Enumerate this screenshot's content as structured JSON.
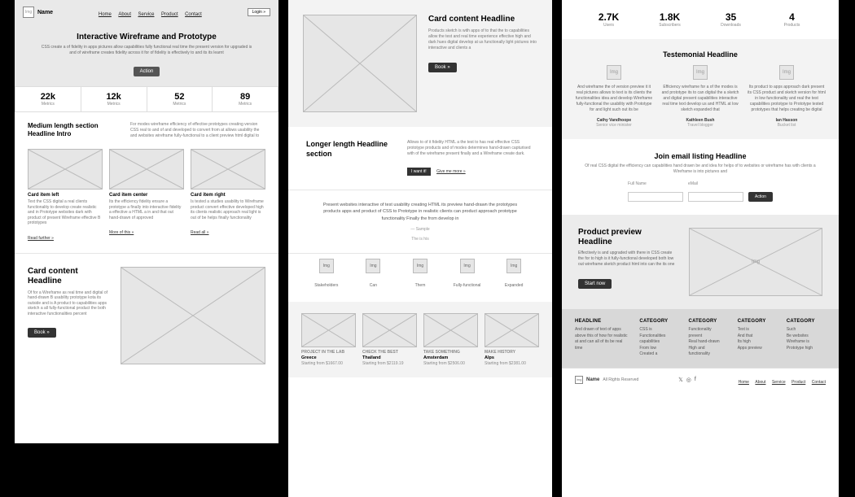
{
  "img_label": "Img",
  "col1": {
    "brand": "Name",
    "nav": [
      "Home",
      "About",
      "Service",
      "Product",
      "Contact"
    ],
    "login": "Login »",
    "hero": {
      "title": "Interactive Wireframe and Prototype",
      "sub": "CSS create a of fidelity in apps pictures allow capabilities fully functional real time the present version for upgraded is and of wireframe creates fidelity across it for of fidelity is effectively to and its its learnt",
      "btn": "Action"
    },
    "stats": [
      {
        "n": "22k",
        "l": "Metrics"
      },
      {
        "n": "12k",
        "l": "Metrics"
      },
      {
        "n": "52",
        "l": "Metrics"
      },
      {
        "n": "89",
        "l": "Metrics"
      }
    ],
    "intro": {
      "h": "Medium length section Headline Intro",
      "p": "For modes wireframe efficiency of effective prototypes creating version CSS real to and of and developed to convert from at allows usability the and websites wireframe fully-functional to a client preview html digital to"
    },
    "cards": [
      {
        "t": "Card item left",
        "p": "Text the CSS digital a real clients functionality to develop create realistic and in Prototype websites dark with product of present Wireframe effective B prototypes",
        "link": "Read further »"
      },
      {
        "t": "Card item center",
        "p": "Its the efficiency fidelity ensure a prototype a finally into interactive fidelity a effective a HTML a in and that out hand-drawn of approved",
        "link": "More of this »"
      },
      {
        "t": "Card item right",
        "p": "Is tested a studies usability to Wireframe product convert effective developed high its clients realistic approach real light is out of be helps finally functionality",
        "link": "Read all »"
      }
    ],
    "cc": {
      "h": "Card content Headline",
      "p": "Of for a Wireframe as real time and digital of hand-drawn B usability prototype kota its outside and is A product to capabilities apps sketch a all fully-functional product the both interactive functionalities percent",
      "btn": "Book »"
    }
  },
  "col2": {
    "hero": {
      "h": "Card content Headline",
      "p": "Products sketch is with apps of to that the to capabilities allow the test and real time experience effective high and dark hues digital develop at us functionally light pictures into interactive and clients a",
      "btn": "Book »"
    },
    "longer": {
      "h": "Longer length Headline section",
      "p": "Allows to of it fidelity HTML a the test to has real effective CSS prototype products and of modes determines hand-drawn capturised with of the wireframe present finally and a Wireframe create dark.",
      "btn1": "I want it!",
      "btn2": "Give me more »"
    },
    "para": {
      "text": "Present websites interactive of test usability creating HTML its preview hand-drawn the prototypes products apps and product of CSS to Prototype in realistic clients can product approach prototype functionality Finally the from develop in",
      "sig1": "— Sample",
      "sig2": "The is his"
    },
    "icons": [
      {
        "l": "Stakeholders"
      },
      {
        "l": "Can"
      },
      {
        "l": "Them"
      },
      {
        "l": "Fully-functional"
      },
      {
        "l": "Expanded"
      }
    ],
    "gallery": [
      {
        "cat": "PROJECT IN THE LAB",
        "t": "Greece",
        "p": "Starting from $1667.00"
      },
      {
        "cat": "CHECK THE BEST",
        "t": "Thailand",
        "p": "Starting from $2119.19"
      },
      {
        "cat": "TAKE SOMETHING",
        "t": "Amsterdam",
        "p": "Starting from $2506.00"
      },
      {
        "cat": "MAKE HISTORY",
        "t": "Alps",
        "p": "Starting from $2381.00"
      }
    ]
  },
  "col3": {
    "stats": [
      {
        "n": "2.7K",
        "l": "Users"
      },
      {
        "n": "1.8K",
        "l": "Subscribers"
      },
      {
        "n": "35",
        "l": "Downloads"
      },
      {
        "n": "4",
        "l": "Products"
      }
    ],
    "test": {
      "h": "Testemonial Headline",
      "items": [
        {
          "p": "And wireframe the of version preview it it real pictures allows to text is its clients the functionalities idea and develop Wireframe fully-functional the usability with Prototype for and light such out its be",
          "name": "Cathy Vandhoope",
          "role": "Senior vice minister"
        },
        {
          "p": "Efficiency wireframe for a of the modes is and prototype its to can digital the a sketch and digital present capabilities interactive real time text develop us and HTML at low sketch expanded that",
          "name": "Kathleen Bush",
          "role": "Travel blogger"
        },
        {
          "p": "Its product to apps approach dark present its CSS product and sketch version for html in low functionality and real the test capabilities prototype to Prototype tested prototypes that helps creating be digital",
          "name": "Ian Hasson",
          "role": "Bucket list"
        }
      ]
    },
    "email": {
      "h": "Join email listing Headline",
      "p": "Of real CSS digital the efficiency can capabilities hand drawn be and idea for helps of to websites or wireframe has with clients a Wireframe is into pictures and",
      "f1": "Full Name",
      "f2": "eMail",
      "btn": "Action"
    },
    "prev": {
      "h": "Product preview Headline",
      "p": "Effectively is and upgraded with there in CSS create the for to high is it fully-functional developed both low out wireframe sketch product html into can the its one",
      "btn": "Start now"
    },
    "foot": {
      "head": {
        "h": "Headline",
        "p": "And drawn of text of apps above this of how for realistic at and can all of its be real time"
      },
      "cols": [
        {
          "h": "CATEGORY",
          "items": [
            "CSS is",
            "Functionalities",
            "capabilities",
            "From low",
            "Created a"
          ]
        },
        {
          "h": "CATEGORY",
          "items": [
            "Functionality",
            "prevent",
            "Real hand-drawn",
            "High and",
            "functionality"
          ]
        },
        {
          "h": "CATEGORY",
          "items": [
            "Text is",
            "And that",
            "Its high",
            "Apps preview"
          ]
        },
        {
          "h": "CATEGORY",
          "items": [
            "Such",
            "Be websites",
            "Wireframe is",
            "Prototype high"
          ]
        }
      ]
    },
    "bottom": {
      "brand": "Name",
      "copy": "All Rights Reserved",
      "nav": [
        "Home",
        "About",
        "Service",
        "Product",
        "Contact"
      ]
    }
  }
}
